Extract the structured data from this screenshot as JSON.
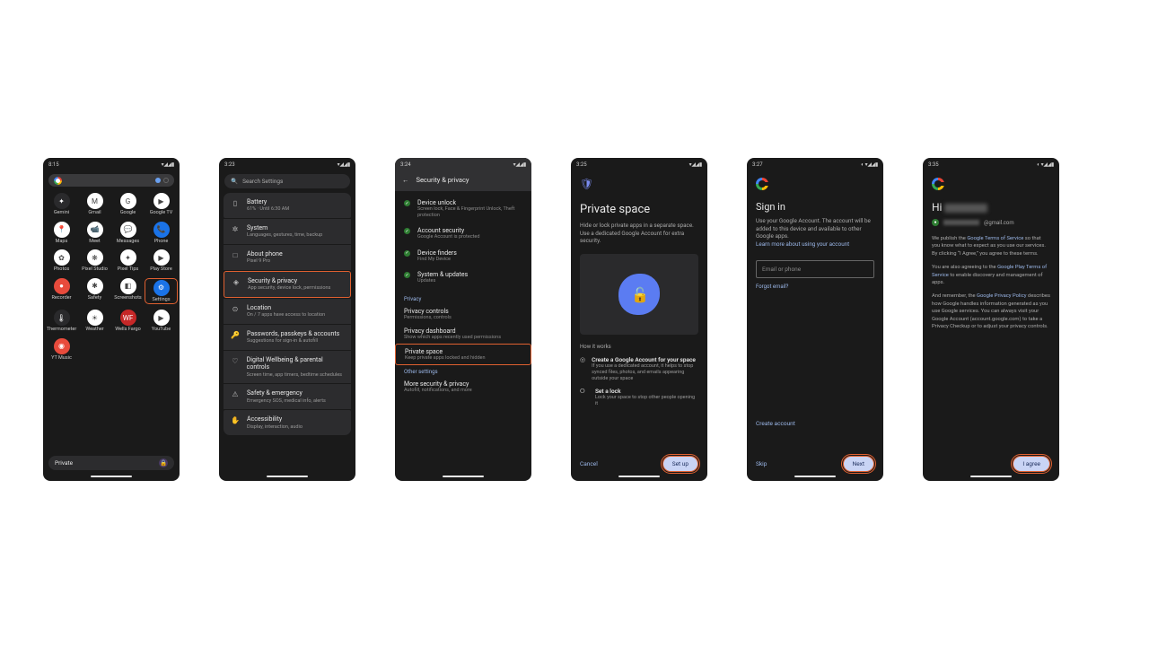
{
  "colors": {
    "highlight": "#e06030",
    "accent": "#9bb7e8"
  },
  "s1": {
    "time": "8:15",
    "signal": "▾◢◢▮",
    "apps_r1": [
      {
        "label": "Gemini",
        "bg": "#2a2a2c",
        "glyph": "✦"
      },
      {
        "label": "Gmail",
        "bg": "#fff",
        "glyph": "M"
      },
      {
        "label": "Google",
        "bg": "#fff",
        "glyph": "G"
      },
      {
        "label": "Google TV",
        "bg": "#fff",
        "glyph": "▶"
      }
    ],
    "apps_r2": [
      {
        "label": "Maps",
        "bg": "#fff",
        "glyph": "📍"
      },
      {
        "label": "Meet",
        "bg": "#fff",
        "glyph": "📹"
      },
      {
        "label": "Messages",
        "bg": "#fff",
        "glyph": "💬"
      },
      {
        "label": "Phone",
        "bg": "#1a73e8",
        "glyph": "📞"
      }
    ],
    "apps_r3": [
      {
        "label": "Photos",
        "bg": "#fff",
        "glyph": "✿"
      },
      {
        "label": "Pixel Studio",
        "bg": "#fff",
        "glyph": "❋"
      },
      {
        "label": "Pixel Tips",
        "bg": "#fff",
        "glyph": "✦"
      },
      {
        "label": "Play Store",
        "bg": "#fff",
        "glyph": "▶"
      }
    ],
    "apps_r4": [
      {
        "label": "Recorder",
        "bg": "#e84b3c",
        "glyph": "●"
      },
      {
        "label": "Safety",
        "bg": "#fff",
        "glyph": "✱"
      },
      {
        "label": "Screenshots",
        "bg": "#fff",
        "glyph": "◧"
      },
      {
        "label": "Settings",
        "bg": "#1a73e8",
        "glyph": "⚙",
        "hl": true
      }
    ],
    "apps_r5": [
      {
        "label": "Thermometer",
        "bg": "#2a2a2c",
        "glyph": "🌡"
      },
      {
        "label": "Weather",
        "bg": "#fff",
        "glyph": "☀"
      },
      {
        "label": "Wells Fargo",
        "bg": "#c62828",
        "glyph": "WF"
      },
      {
        "label": "YouTube",
        "bg": "#fff",
        "glyph": "▶"
      }
    ],
    "apps_r6": [
      {
        "label": "YT Music",
        "bg": "#e84b3c",
        "glyph": "◉"
      }
    ],
    "bottom_label": "Private"
  },
  "s2": {
    "time": "3:23",
    "signal": "▾◢◢▮",
    "search_ph": "Search Settings",
    "rows": [
      {
        "icon": "▯",
        "title": "Battery",
        "sub": "61% · Until 6:30 AM"
      },
      {
        "icon": "✲",
        "title": "System",
        "sub": "Languages, gestures, time, backup"
      },
      {
        "icon": "□",
        "title": "About phone",
        "sub": "Pixel 9 Pro"
      },
      {
        "icon": "◈",
        "title": "Security & privacy",
        "sub": "App security, device lock, permissions",
        "hl": true
      },
      {
        "icon": "⊙",
        "title": "Location",
        "sub": "On / 7 apps have access to location"
      },
      {
        "icon": "🔑",
        "title": "Passwords, passkeys & accounts",
        "sub": "Suggestions for sign-in & autofill"
      },
      {
        "icon": "♡",
        "title": "Digital Wellbeing & parental controls",
        "sub": "Screen time, app timers, bedtime schedules"
      },
      {
        "icon": "⚠",
        "title": "Safety & emergency",
        "sub": "Emergency SOS, medical info, alerts"
      },
      {
        "icon": "✋",
        "title": "Accessibility",
        "sub": "Display, interaction, audio"
      }
    ]
  },
  "s3": {
    "time": "3:24",
    "signal": "▾◢◢▮",
    "header": "Security & privacy",
    "green_items": [
      {
        "title": "Device unlock",
        "sub": "Screen lock, Face & Fingerprint Unlock, Theft protection"
      },
      {
        "title": "Account security",
        "sub": "Google Account is protected"
      },
      {
        "title": "Device finders",
        "sub": "Find My Device"
      },
      {
        "title": "System & updates",
        "sub": "Updates"
      }
    ],
    "cat1": "Privacy",
    "privacy_items": [
      {
        "title": "Privacy controls",
        "sub": "Permissions, controls"
      },
      {
        "title": "Privacy dashboard",
        "sub": "Show which apps recently used permissions"
      },
      {
        "title": "Private space",
        "sub": "Keep private apps locked and hidden",
        "hl": true
      }
    ],
    "cat2": "Other settings",
    "more": {
      "title": "More security & privacy",
      "sub": "Autofill, notifications, and more"
    }
  },
  "s4": {
    "time": "3:25",
    "signal": "▾◢◢▮",
    "title": "Private space",
    "sub": "Hide or lock private apps in a separate space. Use a dedicated Google Account for extra security.",
    "hiw": "How it works",
    "steps": [
      {
        "icon": "◎",
        "title": "Create a Google Account for your space",
        "sub": "If you use a dedicated account, it helps to stop synced files, photos, and emails appearing outside your space"
      },
      {
        "icon": "⭘",
        "title": "Set a lock",
        "sub": "Lock your space to stop other people opening it"
      }
    ],
    "cancel": "Cancel",
    "setup": "Set up"
  },
  "s5": {
    "time": "3:27",
    "signal": "◐ ▾◢◢▮",
    "title": "Sign in",
    "sub": "Use your Google Account. The account will be added to this device and available to other Google apps.",
    "learn": "Learn more about using your account",
    "field_ph": "Email or phone",
    "forgot": "Forgot email?",
    "create": "Create account",
    "skip": "Skip",
    "next": "Next"
  },
  "s6": {
    "time": "3:35",
    "signal": "◐ ▾◢◢▮",
    "hi_prefix": "Hi ",
    "email_suffix": "@gmail.com",
    "p1a": "We publish the ",
    "p1_link1": "Google Terms of Service",
    "p1b": " so that you know what to expect as you use our services. By clicking “I Agree,” you agree to these terms.",
    "p2a": "You are also agreeing to the ",
    "p2_link1": "Google Play Terms of Service",
    "p2b": " to enable discovery and management of apps.",
    "p3a": "And remember, the ",
    "p3_link1": "Google Privacy Policy",
    "p3b": " describes how Google handles information generated as you use Google services. You can always visit your Google Account (account.google.com) to take a Privacy Checkup or to adjust your privacy controls.",
    "agree": "I agree"
  }
}
